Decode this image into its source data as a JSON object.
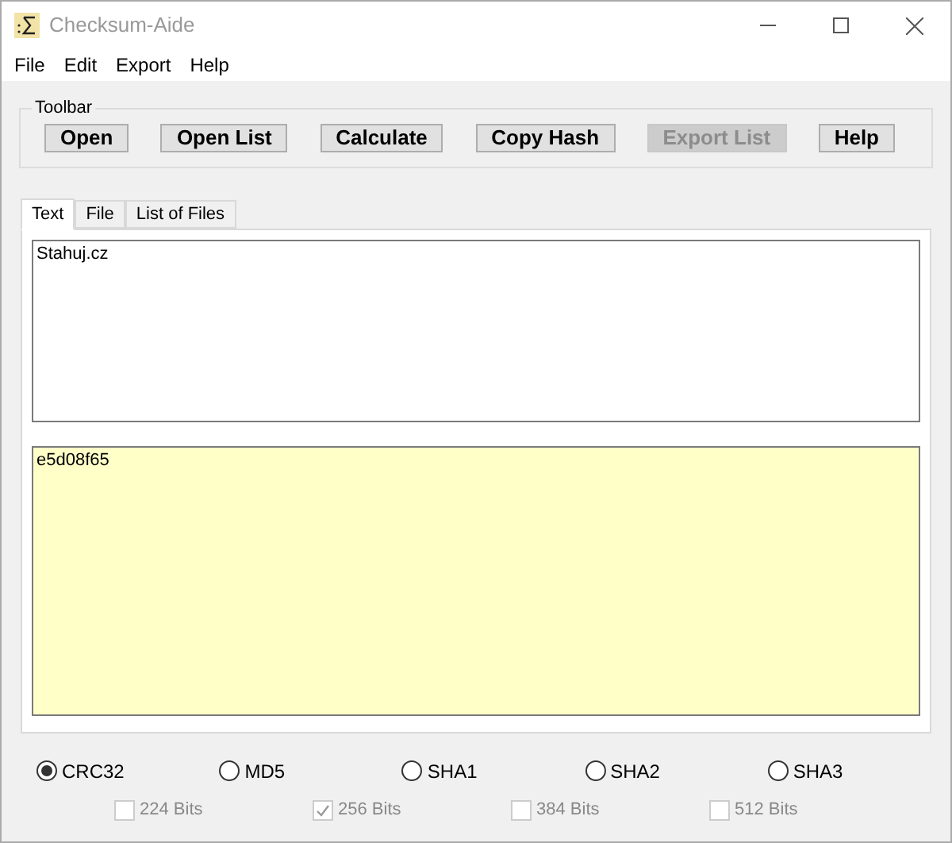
{
  "window": {
    "title": "Checksum-Aide"
  },
  "menu": [
    "File",
    "Edit",
    "Export",
    "Help"
  ],
  "toolbar": {
    "title": "Toolbar",
    "buttons": [
      {
        "label": "Open",
        "disabled": false
      },
      {
        "label": "Open List",
        "disabled": false
      },
      {
        "label": "Calculate",
        "disabled": false
      },
      {
        "label": "Copy Hash",
        "disabled": false
      },
      {
        "label": "Export List",
        "disabled": true
      },
      {
        "label": "Help",
        "disabled": false
      }
    ]
  },
  "tabs": [
    {
      "label": "Text",
      "selected": true
    },
    {
      "label": "File",
      "selected": false
    },
    {
      "label": "List of Files",
      "selected": false
    }
  ],
  "input_text": "Stahuj.cz",
  "hash_output": "e5d08f65",
  "algorithms": [
    {
      "label": "CRC32",
      "selected": true
    },
    {
      "label": "MD5",
      "selected": false
    },
    {
      "label": "SHA1",
      "selected": false
    },
    {
      "label": "SHA2",
      "selected": false
    },
    {
      "label": "SHA3",
      "selected": false
    }
  ],
  "bit_sizes": [
    {
      "label": "224 Bits",
      "checked": false,
      "disabled": true
    },
    {
      "label": "256 Bits",
      "checked": true,
      "disabled": true
    },
    {
      "label": "384 Bits",
      "checked": false,
      "disabled": true
    },
    {
      "label": "512 Bits",
      "checked": false,
      "disabled": true
    }
  ]
}
